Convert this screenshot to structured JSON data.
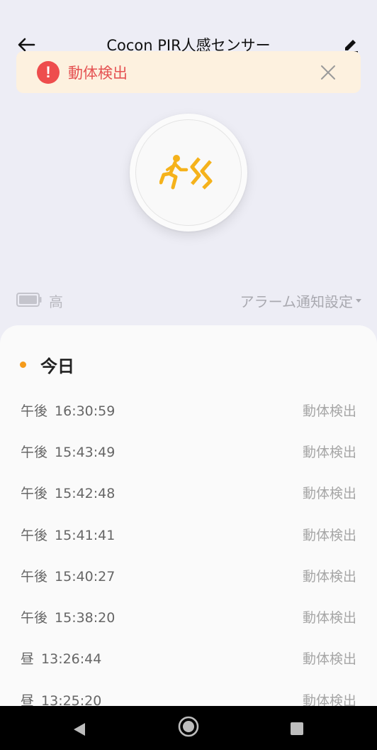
{
  "header": {
    "title": "Cocon PIR人感センサー"
  },
  "alert": {
    "text": "動体検出",
    "icon": "exclamation-icon",
    "mark": "!"
  },
  "sensor": {
    "icon": "running-motion-icon"
  },
  "status": {
    "battery_level": "高",
    "alarm_setting_label": "アラーム通知設定"
  },
  "log": {
    "section_label": "今日",
    "entries": [
      {
        "period": "午後",
        "time": "16:30:59",
        "event": "動体検出"
      },
      {
        "period": "午後",
        "time": "15:43:49",
        "event": "動体検出"
      },
      {
        "period": "午後",
        "time": "15:42:48",
        "event": "動体検出"
      },
      {
        "period": "午後",
        "time": "15:41:41",
        "event": "動体検出"
      },
      {
        "period": "午後",
        "time": "15:40:27",
        "event": "動体検出"
      },
      {
        "period": "午後",
        "time": "15:38:20",
        "event": "動体検出"
      },
      {
        "period": "昼",
        "time": "13:26:44",
        "event": "動体検出"
      },
      {
        "period": "昼",
        "time": "13:25:20",
        "event": "動体検出"
      }
    ]
  },
  "colors": {
    "accent": "#f5b21b",
    "alert_red": "#ee4d4d",
    "alert_bg": "#fdf1df",
    "dot": "#f59b1b"
  }
}
